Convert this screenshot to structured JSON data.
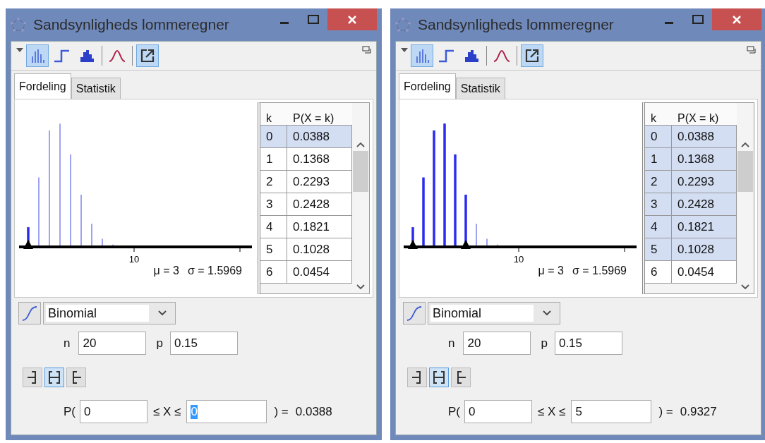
{
  "windows": [
    {
      "title": "Sandsynligheds lommeregner",
      "toolbar": [
        {
          "kind": "bars",
          "selected": true
        },
        {
          "kind": "step",
          "selected": false
        },
        {
          "kind": "histogram",
          "selected": false
        },
        {
          "kind": "curve",
          "selected": false
        },
        {
          "kind": "export",
          "selected": true
        }
      ],
      "tabs": [
        {
          "label": "Fordeling",
          "selected": true
        },
        {
          "label": "Statistik",
          "selected": false
        }
      ],
      "chart": {
        "tick_label": "10",
        "mean": "μ = 3",
        "sd": "σ = 1.5969"
      },
      "table": {
        "columns": [
          "k",
          "P(X = k)"
        ],
        "rows": [
          {
            "cells": [
              "0",
              "0.0388"
            ],
            "selected": true
          },
          {
            "cells": [
              "1",
              "0.1368"
            ],
            "selected": false
          },
          {
            "cells": [
              "2",
              "0.2293"
            ],
            "selected": false
          },
          {
            "cells": [
              "3",
              "0.2428"
            ],
            "selected": false
          },
          {
            "cells": [
              "4",
              "0.1821"
            ],
            "selected": false
          },
          {
            "cells": [
              "5",
              "0.1028"
            ],
            "selected": false
          },
          {
            "cells": [
              "6",
              "0.0454"
            ],
            "selected": false
          }
        ]
      },
      "distribution": "Binomial",
      "params": [
        {
          "label": "n",
          "value": "20"
        },
        {
          "label": "p",
          "value": "0.15"
        }
      ],
      "interval_modes": [
        {
          "kind": "left",
          "selected": false
        },
        {
          "kind": "both",
          "selected": true
        },
        {
          "kind": "right",
          "selected": false
        }
      ],
      "probability": {
        "prefix": "P(",
        "lower": "0",
        "relation": "≤ X ≤",
        "upper": "0",
        "upper_selected": true,
        "suffix": ") =",
        "result": "0.0388"
      }
    },
    {
      "title": "Sandsynligheds lommeregner",
      "toolbar": [
        {
          "kind": "bars",
          "selected": true
        },
        {
          "kind": "step",
          "selected": false
        },
        {
          "kind": "histogram",
          "selected": false
        },
        {
          "kind": "curve",
          "selected": false
        },
        {
          "kind": "export",
          "selected": true
        }
      ],
      "tabs": [
        {
          "label": "Fordeling",
          "selected": true
        },
        {
          "label": "Statistik",
          "selected": false
        }
      ],
      "chart": {
        "tick_label": "10",
        "mean": "μ = 3",
        "sd": "σ = 1.5969"
      },
      "table": {
        "columns": [
          "k",
          "P(X = k)"
        ],
        "rows": [
          {
            "cells": [
              "0",
              "0.0388"
            ],
            "selected": true
          },
          {
            "cells": [
              "1",
              "0.1368"
            ],
            "selected": true
          },
          {
            "cells": [
              "2",
              "0.2293"
            ],
            "selected": true
          },
          {
            "cells": [
              "3",
              "0.2428"
            ],
            "selected": true
          },
          {
            "cells": [
              "4",
              "0.1821"
            ],
            "selected": true
          },
          {
            "cells": [
              "5",
              "0.1028"
            ],
            "selected": true
          },
          {
            "cells": [
              "6",
              "0.0454"
            ],
            "selected": false
          }
        ]
      },
      "distribution": "Binomial",
      "params": [
        {
          "label": "n",
          "value": "20"
        },
        {
          "label": "p",
          "value": "0.15"
        }
      ],
      "interval_modes": [
        {
          "kind": "left",
          "selected": false
        },
        {
          "kind": "both",
          "selected": true
        },
        {
          "kind": "right",
          "selected": false
        }
      ],
      "probability": {
        "prefix": "P(",
        "lower": "0",
        "relation": "≤ X ≤",
        "upper": "5",
        "upper_selected": false,
        "suffix": ") =",
        "result": "0.9327"
      }
    }
  ]
}
